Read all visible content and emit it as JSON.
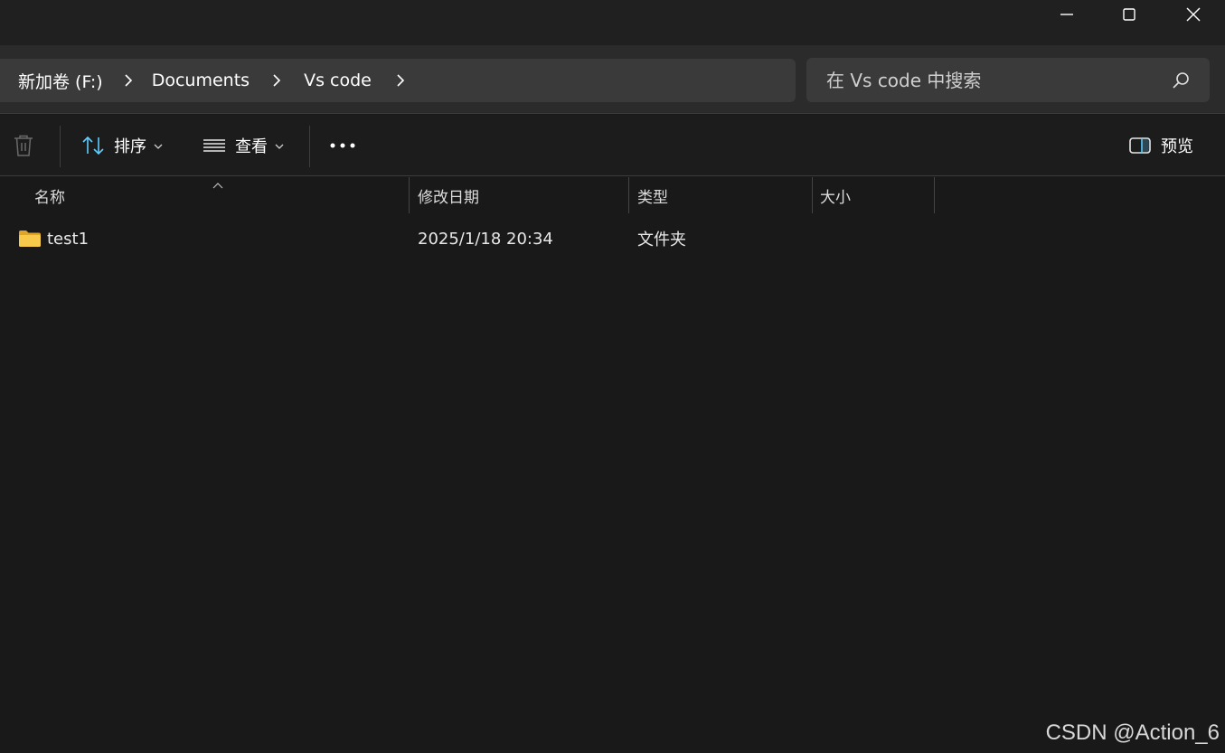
{
  "window": {
    "controls": {
      "minimize": "minimize-icon",
      "maximize": "maximize-icon",
      "close": "close-icon"
    }
  },
  "address": {
    "breadcrumbs": [
      "新加卷 (F:)",
      "Documents",
      "Vs code"
    ],
    "search_placeholder": "在 Vs code 中搜索"
  },
  "toolbar": {
    "delete_icon": "trash-icon",
    "sort_label": "排序",
    "view_label": "查看",
    "more_icon": "more-icon",
    "preview_label": "预览"
  },
  "columns": {
    "name": "名称",
    "modified": "修改日期",
    "type": "类型",
    "size": "大小"
  },
  "files": [
    {
      "name": "test1",
      "modified": "2025/1/18 20:34",
      "type": "文件夹",
      "size": "",
      "icon": "folder-icon"
    }
  ],
  "watermark": "CSDN @Action_6",
  "colors": {
    "background": "#191919",
    "address_bar": "#2b2b2b",
    "input_bg": "#3a3a3a",
    "accent": "#60cdff",
    "folder": "#f4c542"
  }
}
